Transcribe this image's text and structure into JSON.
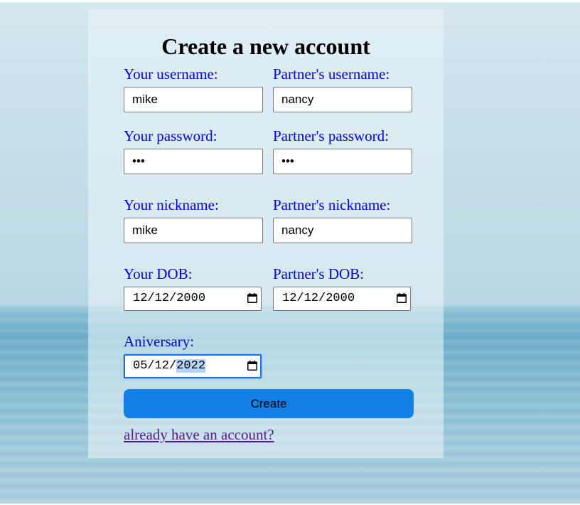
{
  "form": {
    "title": "Create a new account",
    "your_username_label": "Your username:",
    "partner_username_label": "Partner's username:",
    "your_username_value": "mike",
    "partner_username_value": "nancy",
    "your_password_label": "Your password:",
    "partner_password_label": "Partner's password:",
    "your_password_masked": "•••",
    "partner_password_masked": "•••",
    "your_nickname_label": "Your nickname:",
    "partner_nickname_label": "Partner's nickname:",
    "your_nickname_value": "mike",
    "partner_nickname_value": "nancy",
    "your_dob_label": "Your DOB:",
    "partner_dob_label": "Partner's DOB:",
    "your_dob_value": "12/12/2000",
    "partner_dob_value": "12/12/2000",
    "anniversary_label": "Aniversary:",
    "anniversary_value_prefix": "05/12/",
    "anniversary_value_selected": "2022",
    "create_label": "Create",
    "login_link": "already have an account?"
  },
  "icons": {
    "date_picker": "calendar-icon"
  },
  "colors": {
    "label_text": "#0000ee",
    "visited_link": "#551a8b",
    "button_bg": "#127fe6",
    "focus_ring": "#1a73e8",
    "selection": "#b3d4fc"
  }
}
